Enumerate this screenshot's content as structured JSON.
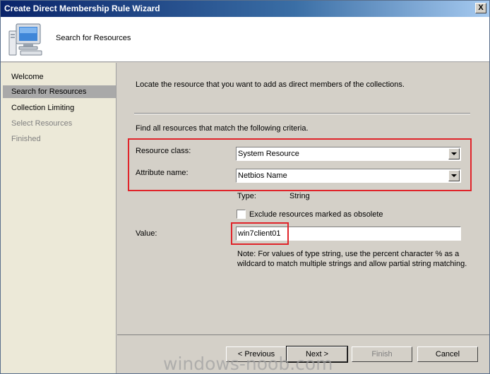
{
  "window": {
    "title": "Create Direct Membership Rule Wizard",
    "close_label": "X"
  },
  "header": {
    "title": "Search for Resources",
    "icon": "computer-icon"
  },
  "sidebar": {
    "items": [
      {
        "label": "Welcome",
        "state": "normal"
      },
      {
        "label": "Search for Resources",
        "state": "active"
      },
      {
        "label": "Collection Limiting",
        "state": "normal"
      },
      {
        "label": "Select Resources",
        "state": "disabled"
      },
      {
        "label": "Finished",
        "state": "disabled"
      }
    ]
  },
  "main": {
    "intro": "Locate the resource that you want to add as direct members of the collections.",
    "criteria_text": "Find all resources that match the following criteria.",
    "resource_class_label": "Resource class:",
    "resource_class_value": "System Resource",
    "attribute_name_label": "Attribute name:",
    "attribute_name_value": "Netbios Name",
    "type_label": "Type:",
    "type_value": "String",
    "exclude_label": "Exclude resources marked as obsolete",
    "value_label": "Value:",
    "value_input": "win7client01",
    "note": "Note: For values of type string, use the percent character % as a wildcard to match multiple strings and allow partial string matching."
  },
  "footer": {
    "previous_label": "< Previous",
    "next_label": "Next >",
    "finish_label": "Finish",
    "cancel_label": "Cancel"
  },
  "watermark": "windows-noob.com",
  "colors": {
    "highlight": "#e0242a",
    "title_bar": "#0a246a"
  }
}
